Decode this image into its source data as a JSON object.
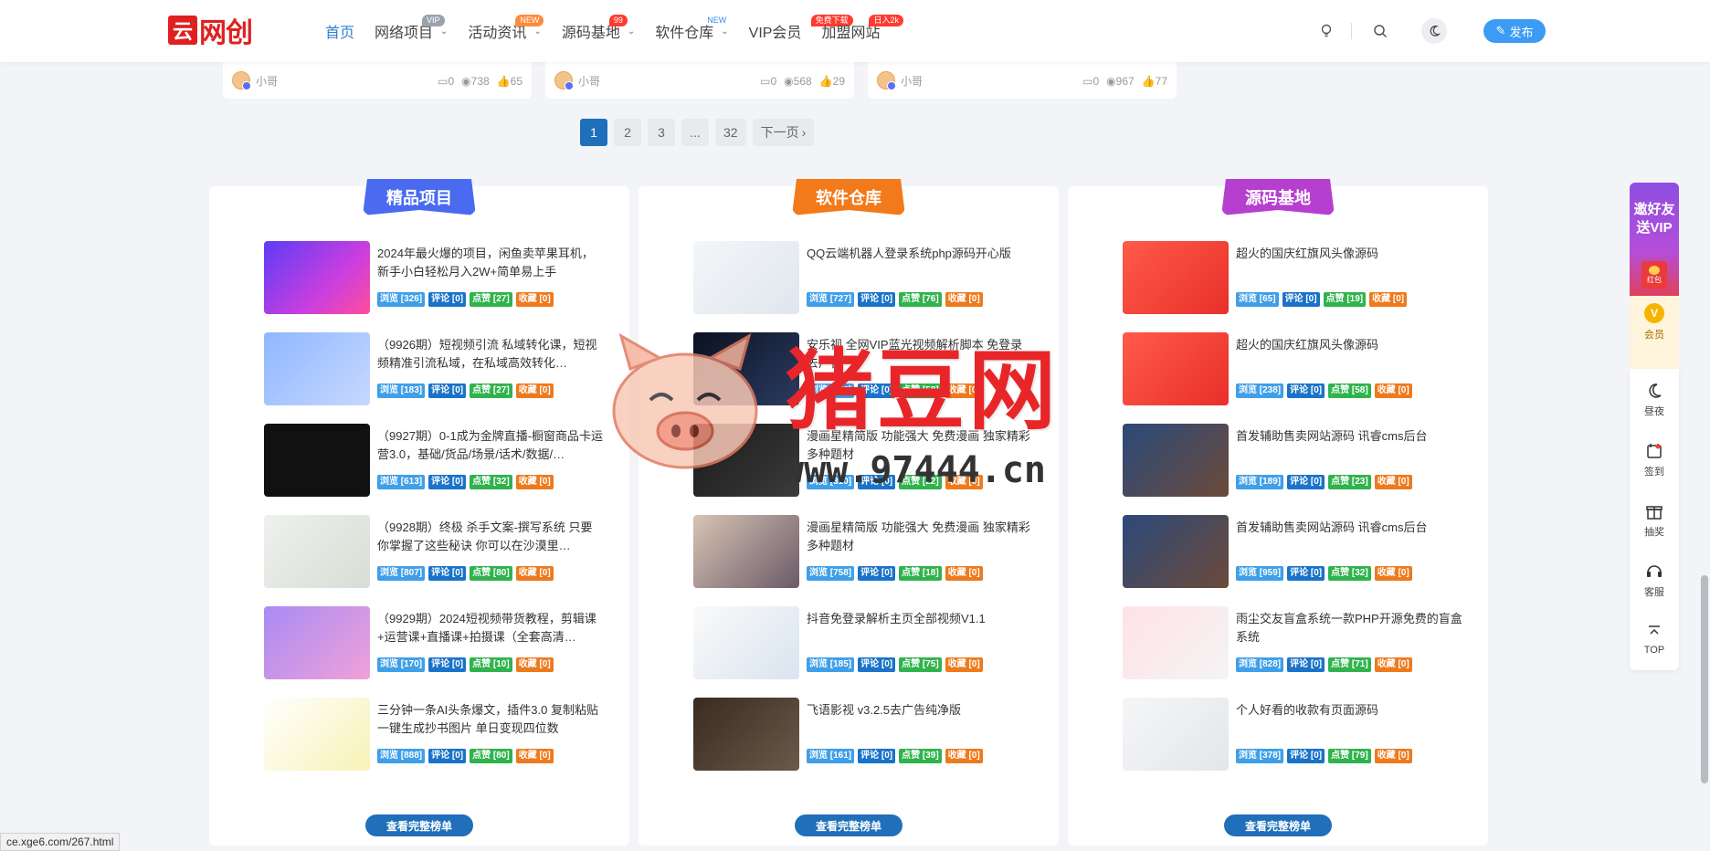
{
  "logo": {
    "mark": "云",
    "text": "网创"
  },
  "nav": [
    {
      "label": "首页",
      "badge": "",
      "active": true,
      "dropdown": false
    },
    {
      "label": "网络项目",
      "badge": "VIP",
      "dropdown": true
    },
    {
      "label": "活动资讯",
      "badge": "NEW",
      "dropdown": true
    },
    {
      "label": "源码基地",
      "badge": "99",
      "dropdown": true
    },
    {
      "label": "软件仓库",
      "badge": "NEW",
      "dropdown": true
    },
    {
      "label": "VIP会员",
      "badge": "免费下载",
      "dropdown": false
    },
    {
      "label": "加盟网站",
      "badge": "日入2k",
      "dropdown": false
    }
  ],
  "header_right": {
    "publish_label": "发布"
  },
  "top_cards": [
    {
      "author": "小哥",
      "comments": "0",
      "views": "738",
      "likes": "65"
    },
    {
      "author": "小哥",
      "comments": "0",
      "views": "568",
      "likes": "29"
    },
    {
      "author": "小哥",
      "comments": "0",
      "views": "967",
      "likes": "77"
    }
  ],
  "pagination": {
    "pages": [
      "1",
      "2",
      "3",
      "...",
      "32"
    ],
    "current": "1",
    "next_label": "下一页"
  },
  "columns": [
    {
      "title": "精品项目",
      "color": "#4a6bf0",
      "more_label": "查看完整榜单",
      "items": [
        {
          "title": "2024年最火爆的项目，闲鱼卖苹果耳机，新手小白轻松月入2W+简单易上手",
          "views": "浏览 [326]",
          "comments": "评论 [0]",
          "likes": "点赞 [27]",
          "favs": "收藏 [0]"
        },
        {
          "title": "（9926期）短视频引流 私域转化课，短视频精准引流私域，在私域高效转化…",
          "views": "浏览 [183]",
          "comments": "评论 [0]",
          "likes": "点赞 [27]",
          "favs": "收藏 [0]"
        },
        {
          "title": "（9927期）0-1成为金牌直播-橱窗商品卡运营3.0，基础/货品/场景/话术/数据/…",
          "views": "浏览 [613]",
          "comments": "评论 [0]",
          "likes": "点赞 [32]",
          "favs": "收藏 [0]"
        },
        {
          "title": "（9928期）终极 杀手文案-撰写系统 只要你掌握了这些秘诀 你可以在沙漠里…",
          "views": "浏览 [807]",
          "comments": "评论 [0]",
          "likes": "点赞 [80]",
          "favs": "收藏 [0]"
        },
        {
          "title": "（9929期）2024短视频带货教程，剪辑课+运营课+直播课+拍摄课（全套高清…",
          "views": "浏览 [170]",
          "comments": "评论 [0]",
          "likes": "点赞 [10]",
          "favs": "收藏 [0]"
        },
        {
          "title": "三分钟一条AI头条爆文，插件3.0 复制粘贴一键生成抄书图片 单日变现四位数",
          "views": "浏览 [888]",
          "comments": "评论 [0]",
          "likes": "点赞 [80]",
          "favs": "收藏 [0]"
        }
      ]
    },
    {
      "title": "软件仓库",
      "color": "#f27a1a",
      "more_label": "查看完整榜单",
      "items": [
        {
          "title": "QQ云端机器人登录系统php源码开心版",
          "views": "浏览 [727]",
          "comments": "评论 [0]",
          "likes": "点赞 [76]",
          "favs": "收藏 [0]"
        },
        {
          "title": "安乐视 全网VIP蓝光视频解析脚本 免登录 去广告",
          "views": "浏览 [178]",
          "comments": "评论 [0]",
          "likes": "点赞 [58]",
          "favs": "收藏 [0]"
        },
        {
          "title": "漫画星精简版 功能强大 免费漫画 独家精彩 多种题材",
          "views": "浏览 [310]",
          "comments": "评论 [0]",
          "likes": "点赞 [22]",
          "favs": "收藏 [0]"
        },
        {
          "title": "漫画星精简版 功能强大 免费漫画 独家精彩 多种题材",
          "views": "浏览 [758]",
          "comments": "评论 [0]",
          "likes": "点赞 [18]",
          "favs": "收藏 [0]"
        },
        {
          "title": "抖音免登录解析主页全部视频V1.1",
          "views": "浏览 [185]",
          "comments": "评论 [0]",
          "likes": "点赞 [75]",
          "favs": "收藏 [0]"
        },
        {
          "title": "飞语影视 v3.2.5去广告纯净版",
          "views": "浏览 [161]",
          "comments": "评论 [0]",
          "likes": "点赞 [39]",
          "favs": "收藏 [0]"
        }
      ]
    },
    {
      "title": "源码基地",
      "color": "#b63fd0",
      "more_label": "查看完整榜单",
      "items": [
        {
          "title": "超火的国庆红旗风头像源码",
          "views": "浏览 [65]",
          "comments": "评论 [0]",
          "likes": "点赞 [19]",
          "favs": "收藏 [0]"
        },
        {
          "title": "超火的国庆红旗风头像源码",
          "views": "浏览 [238]",
          "comments": "评论 [0]",
          "likes": "点赞 [58]",
          "favs": "收藏 [0]"
        },
        {
          "title": "首发辅助售卖网站源码 讯睿cms后台",
          "views": "浏览 [189]",
          "comments": "评论 [0]",
          "likes": "点赞 [23]",
          "favs": "收藏 [0]"
        },
        {
          "title": "首发辅助售卖网站源码 讯睿cms后台",
          "views": "浏览 [959]",
          "comments": "评论 [0]",
          "likes": "点赞 [32]",
          "favs": "收藏 [0]"
        },
        {
          "title": "雨尘交友盲盒系统一款PHP开源免费的盲盒系统",
          "views": "浏览 [828]",
          "comments": "评论 [0]",
          "likes": "点赞 [71]",
          "favs": "收藏 [0]"
        },
        {
          "title": "个人好看的收款有页面源码",
          "views": "浏览 [378]",
          "comments": "评论 [0]",
          "likes": "点赞 [79]",
          "favs": "收藏 [0]"
        }
      ]
    }
  ],
  "sidebar": {
    "invite_label": "邀好友送VIP",
    "hongbao_label": "红包",
    "vip_label": "会员",
    "buttons": [
      {
        "label": "昼夜",
        "icon": "moon-icon"
      },
      {
        "label": "签到",
        "icon": "calendar-icon"
      },
      {
        "label": "抽奖",
        "icon": "gift-icon"
      },
      {
        "label": "客服",
        "icon": "headset-icon"
      },
      {
        "label": "TOP",
        "icon": "arrow-up-icon"
      }
    ]
  },
  "watermark": {
    "text": "猪豆网",
    "url": "www.97444.cn"
  },
  "status_url": "ce.xge6.com/267.html"
}
